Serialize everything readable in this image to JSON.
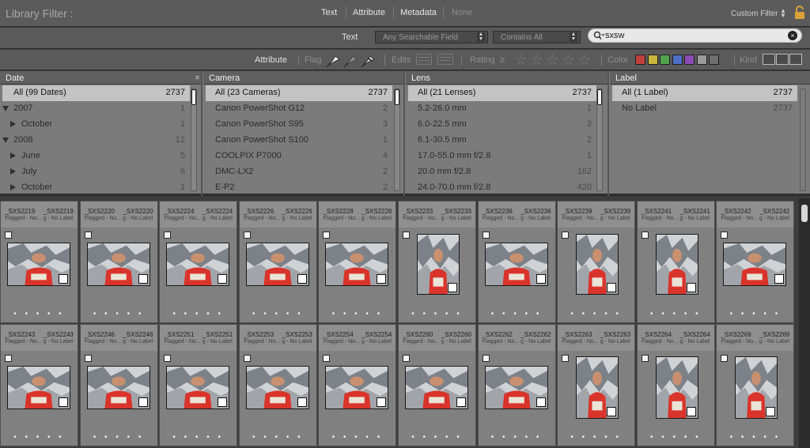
{
  "header": {
    "title": "Library Filter :",
    "modes": [
      "Text",
      "Attribute",
      "Metadata",
      "None"
    ],
    "preset": "Custom Filter"
  },
  "text_filter": {
    "label": "Text",
    "field": "Any Searchable Field",
    "rule": "Contains All",
    "query": "sxsw"
  },
  "attribute_filter": {
    "label": "Attribute",
    "flag_label": "Flag",
    "edits_label": "Edits",
    "rating_label": "Rating",
    "rating_op": "≥",
    "color_label": "Color",
    "kind_label": "Kind",
    "stars": [
      "☆",
      "☆",
      "☆",
      "☆",
      "☆"
    ],
    "colors": [
      "#c0403d",
      "#c9b63b",
      "#52a34d",
      "#4d6fc4",
      "#8a4db4",
      "#9b9b9b",
      "#6f6f6f"
    ]
  },
  "metadata": {
    "date": {
      "header": "Date",
      "items": [
        {
          "name": "All (99 Dates)",
          "count": "2737",
          "selected": true,
          "level": 0,
          "tri": ""
        },
        {
          "name": "2007",
          "count": "1",
          "level": 0,
          "tri": "down"
        },
        {
          "name": "October",
          "count": "1",
          "level": 1,
          "tri": "right"
        },
        {
          "name": "2008",
          "count": "12",
          "level": 0,
          "tri": "down"
        },
        {
          "name": "June",
          "count": "5",
          "level": 1,
          "tri": "right"
        },
        {
          "name": "July",
          "count": "6",
          "level": 1,
          "tri": "right"
        },
        {
          "name": "October",
          "count": "1",
          "level": 1,
          "tri": "right"
        }
      ]
    },
    "camera": {
      "header": "Camera",
      "items": [
        {
          "name": "All (23 Cameras)",
          "count": "2737",
          "selected": true
        },
        {
          "name": "Canon PowerShot G12",
          "count": "2"
        },
        {
          "name": "Canon PowerShot S95",
          "count": "3"
        },
        {
          "name": "Canon PowerShot S100",
          "count": "1"
        },
        {
          "name": "COOLPIX P7000",
          "count": "4"
        },
        {
          "name": "DMC-LX2",
          "count": "2"
        },
        {
          "name": "E-P2",
          "count": "2"
        }
      ]
    },
    "lens": {
      "header": "Lens",
      "items": [
        {
          "name": "All (21 Lenses)",
          "count": "2737",
          "selected": true
        },
        {
          "name": "5.2-26.0 mm",
          "count": "1"
        },
        {
          "name": "6.0-22.5 mm",
          "count": "3"
        },
        {
          "name": "6.1-30.5 mm",
          "count": "2"
        },
        {
          "name": "17.0-55.0 mm f/2.8",
          "count": "1"
        },
        {
          "name": "20.0 mm f/2.8",
          "count": "162"
        },
        {
          "name": "24.0-70.0 mm f/2.8",
          "count": "420"
        }
      ]
    },
    "label": {
      "header": "Label",
      "items": [
        {
          "name": "All (1 Label)",
          "count": "2737",
          "selected": true
        },
        {
          "name": "No Label",
          "count": "2737"
        }
      ]
    }
  },
  "grid": {
    "meta_text": "Flagged - No... g - No Label",
    "dots": "• • • • •",
    "rows": [
      [
        {
          "name": "_SXS2219",
          "file": "_SXS2219",
          "orient": "landscape"
        },
        {
          "name": "_SXS2220",
          "file": "_SXS2220",
          "orient": "landscape"
        },
        {
          "name": "_SXS2224",
          "file": "_SXS2224",
          "orient": "landscape"
        },
        {
          "name": "_SXS2226",
          "file": "_SXS2226",
          "orient": "landscape"
        },
        {
          "name": "_SXS2228",
          "file": "_SXS2228",
          "orient": "landscape"
        },
        {
          "name": "_SXS2233",
          "file": "_SXS2233",
          "orient": "portrait"
        },
        {
          "name": "_SXS2236",
          "file": "_SXS2236",
          "orient": "landscape"
        },
        {
          "name": "_SXS2239",
          "file": "_SXS2239",
          "orient": "portrait"
        },
        {
          "name": "_SXS2241",
          "file": "_SXS2241",
          "orient": "portrait"
        },
        {
          "name": "_SXS2242",
          "file": "_SXS2242",
          "orient": "landscape"
        }
      ],
      [
        {
          "name": "_SXS2243",
          "file": "_SXS2243",
          "orient": "landscape"
        },
        {
          "name": "_SXS2246",
          "file": "_SXS2246",
          "orient": "landscape"
        },
        {
          "name": "_SXS2251",
          "file": "_SXS2251",
          "orient": "landscape"
        },
        {
          "name": "_SXS2253",
          "file": "_SXS2253",
          "orient": "landscape"
        },
        {
          "name": "_SXS2254",
          "file": "_SXS2254",
          "orient": "landscape"
        },
        {
          "name": "_SXS2260",
          "file": "_SXS2260",
          "orient": "landscape"
        },
        {
          "name": "_SXS2262",
          "file": "_SXS2262",
          "orient": "landscape"
        },
        {
          "name": "_SXS2263",
          "file": "_SXS2263",
          "orient": "portrait"
        },
        {
          "name": "_SXS2264",
          "file": "_SXS2264",
          "orient": "portrait"
        },
        {
          "name": "_SXS2269",
          "file": "_SXS2269",
          "orient": "portrait"
        }
      ]
    ]
  }
}
